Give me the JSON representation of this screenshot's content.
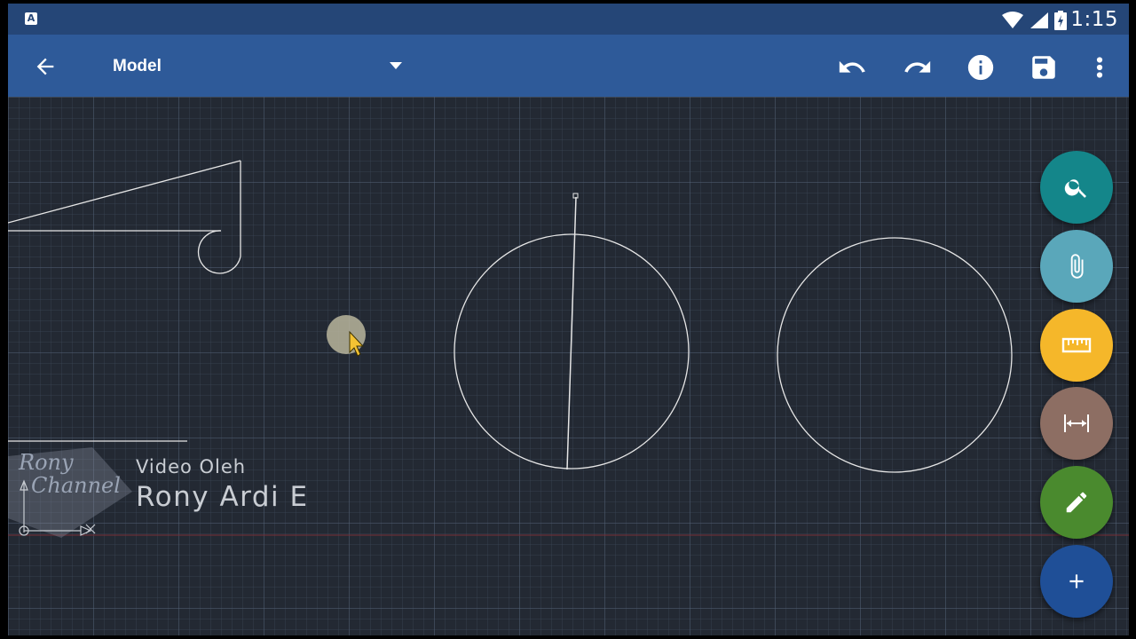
{
  "status_bar": {
    "notification_icon": "A",
    "icons": [
      "wifi-icon",
      "signal-icon",
      "battery-icon"
    ],
    "time": "1:15"
  },
  "app_bar": {
    "title": "Model",
    "actions": [
      "undo-icon",
      "redo-icon",
      "info-icon",
      "save-icon",
      "more-vert-icon"
    ]
  },
  "fabs": [
    {
      "name": "search",
      "color": "#14868a"
    },
    {
      "name": "attach",
      "color": "#5aa7ba"
    },
    {
      "name": "measure",
      "color": "#f5b72a"
    },
    {
      "name": "dimension",
      "color": "#8d6e63"
    },
    {
      "name": "draw",
      "color": "#4a8a2e"
    },
    {
      "name": "add",
      "color": "#1f4f97"
    }
  ],
  "watermark": {
    "logo_line1": "Rony",
    "logo_line2": "Channel",
    "line1": "Video Oleh",
    "line2": "Rony Ardi E"
  },
  "colors": {
    "status_bar": "#254677",
    "app_bar": "#2e5a99",
    "canvas": "#232933",
    "drawing_lines": "#e6e6e6"
  }
}
